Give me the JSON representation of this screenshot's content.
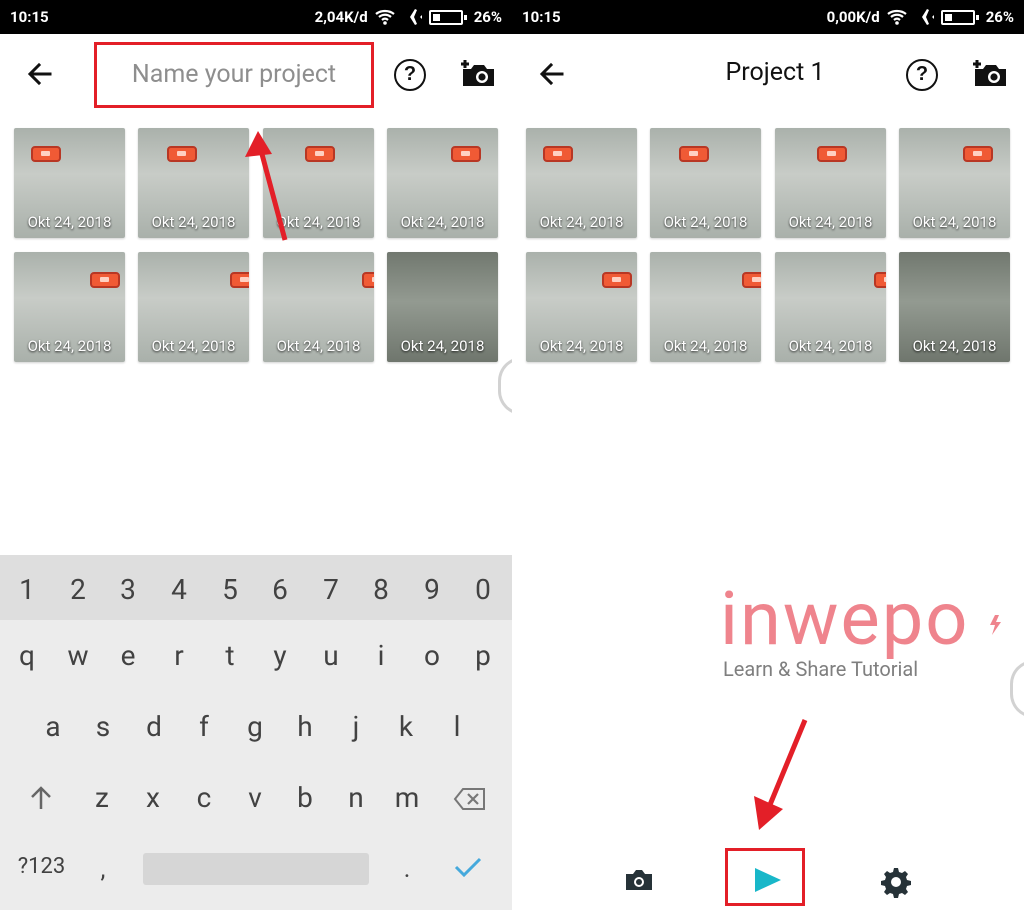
{
  "left_screen": {
    "status": {
      "time": "10:15",
      "speed": "2,04K/d",
      "battery": "26%"
    },
    "project_name_input": {
      "value": "",
      "placeholder": "Name your project"
    },
    "icons": {
      "back": "back-arrow-icon",
      "help": "help-circle-icon",
      "add_photo": "add-photo-camera-icon"
    },
    "photo_dates": [
      "Okt 24, 2018",
      "Okt 24, 2018",
      "Okt 24, 2018",
      "Okt 24, 2018",
      "Okt 24, 2018",
      "Okt 24, 2018",
      "Okt 24, 2018",
      "Okt 24, 2018"
    ],
    "keyboard": {
      "number_row": [
        "1",
        "2",
        "3",
        "4",
        "5",
        "6",
        "7",
        "8",
        "9",
        "0"
      ],
      "row1": [
        "q",
        "w",
        "e",
        "r",
        "t",
        "y",
        "u",
        "i",
        "o",
        "p"
      ],
      "row2": [
        "a",
        "s",
        "d",
        "f",
        "g",
        "h",
        "j",
        "k",
        "l"
      ],
      "row3": [
        "z",
        "x",
        "c",
        "v",
        "b",
        "n",
        "m"
      ],
      "symbols": "?123",
      "comma": ",",
      "period": ".",
      "icons": {
        "shift": "shift-arrow-icon",
        "backspace": "backspace-icon",
        "enter": "checkmark-icon"
      }
    }
  },
  "right_screen": {
    "status": {
      "time": "10:15",
      "speed": "0,00K/d",
      "battery": "26%"
    },
    "project_title": "Project 1",
    "icons": {
      "back": "back-arrow-icon",
      "help": "help-circle-icon",
      "add_photo": "add-photo-camera-icon"
    },
    "photo_dates": [
      "Okt 24, 2018",
      "Okt 24, 2018",
      "Okt 24, 2018",
      "Okt 24, 2018",
      "Okt 24, 2018",
      "Okt 24, 2018",
      "Okt 24, 2018",
      "Okt 24, 2018"
    ],
    "bottom_nav": {
      "camera": "camera-icon",
      "play": "play-icon",
      "settings": "settings-gear-icon"
    }
  },
  "watermark": {
    "brand": "inwepo",
    "tagline": "Learn & Share Tutorial"
  },
  "colors": {
    "highlight_red": "#e31f28",
    "play_teal": "#18b7c9",
    "watermark_pink": "#ef848d"
  }
}
